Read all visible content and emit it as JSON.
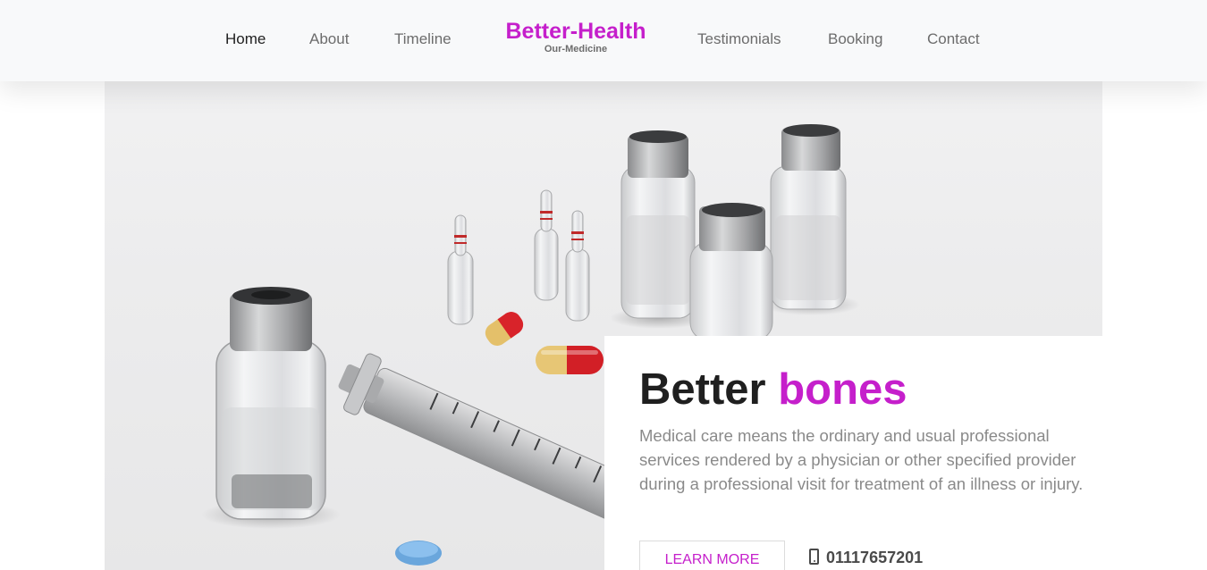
{
  "nav": {
    "items": [
      {
        "label": "Home",
        "active": true
      },
      {
        "label": "About"
      },
      {
        "label": "Timeline"
      },
      {
        "label": "Testimonials"
      },
      {
        "label": "Booking"
      },
      {
        "label": "Contact"
      }
    ],
    "brand": {
      "title": "Better-Health",
      "subtitle": "Our-Medicine"
    }
  },
  "hero": {
    "image_subject": "medical vials, ampoules, capsules and syringe",
    "heading_plain": "Better",
    "heading_accent": "bones",
    "text": "Medical care means the ordinary and usual professional services rendered by a physician or other specified provider during a professional visit for treatment of an illness or injury.",
    "button_label": "LEARN MORE",
    "phone": "01117657201",
    "phone_icon": "mobile-phone-icon"
  },
  "colors": {
    "accent": "#c51fcb",
    "nav_bg": "#f8f9fa",
    "text_dark": "#1f1f1f",
    "text_muted": "#8a8a8a"
  }
}
